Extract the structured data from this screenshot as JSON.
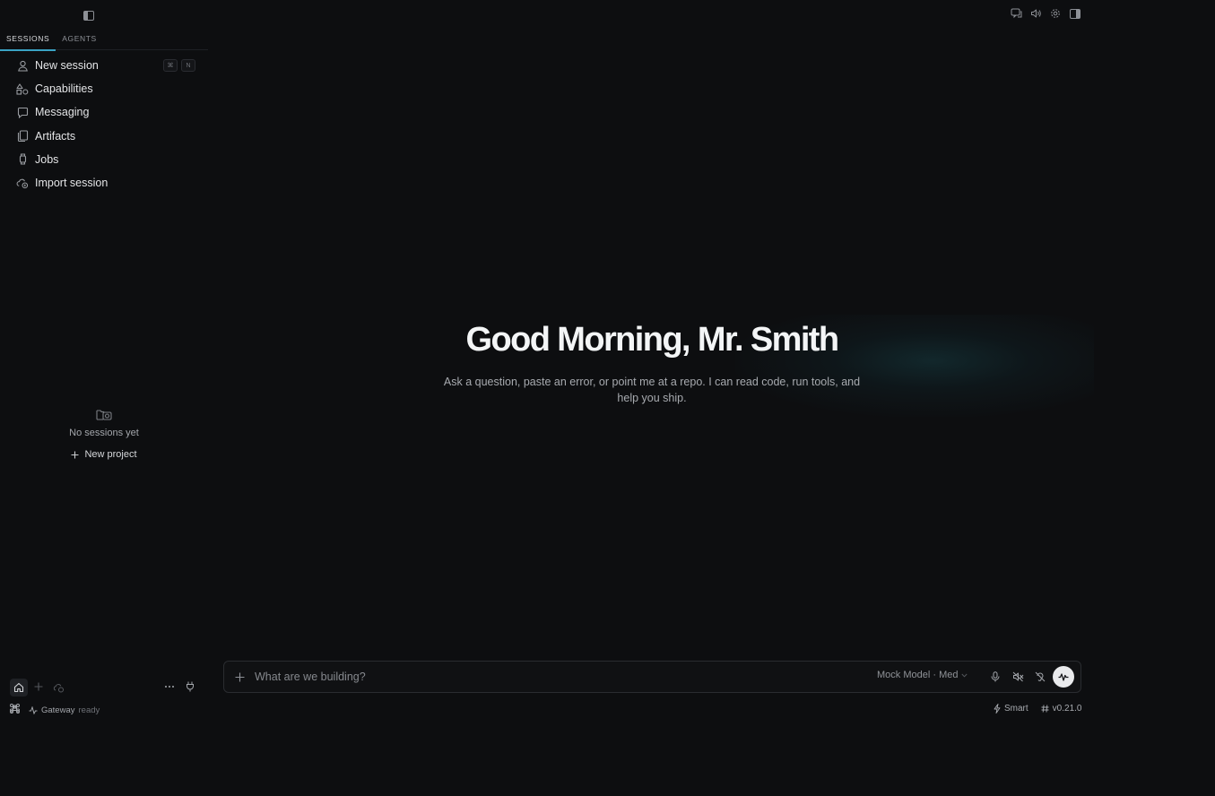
{
  "sidebar": {
    "tabs": [
      {
        "label": "SESSIONS",
        "active": true
      },
      {
        "label": "AGENTS",
        "active": false
      }
    ],
    "items": [
      {
        "label": "New session",
        "icon": "person-icon",
        "shortcut": [
          "⌘",
          "N"
        ]
      },
      {
        "label": "Capabilities",
        "icon": "shapes-icon"
      },
      {
        "label": "Messaging",
        "icon": "chat-bubble-icon"
      },
      {
        "label": "Artifacts",
        "icon": "files-icon"
      },
      {
        "label": "Jobs",
        "icon": "watch-icon"
      },
      {
        "label": "Import session",
        "icon": "cloud-import-icon"
      }
    ],
    "empty_state": {
      "text": "No sessions yet",
      "new_project_label": "New project"
    },
    "status": {
      "gateway_label": "Gateway",
      "gateway_state": "ready"
    }
  },
  "hero": {
    "title": "Good Morning, Mr. Smith",
    "subtitle": "Ask a question, paste an error, or point me at a repo. I can read code, run tools, and help you ship."
  },
  "composer": {
    "placeholder": "What are we building?",
    "model": "Mock Model · Med"
  },
  "footer": {
    "mode": "Smart",
    "version": "v0.21.0"
  },
  "colors": {
    "background": "#0d0e10",
    "accent": "#3aa3c4",
    "text": "#e6e7e9"
  }
}
